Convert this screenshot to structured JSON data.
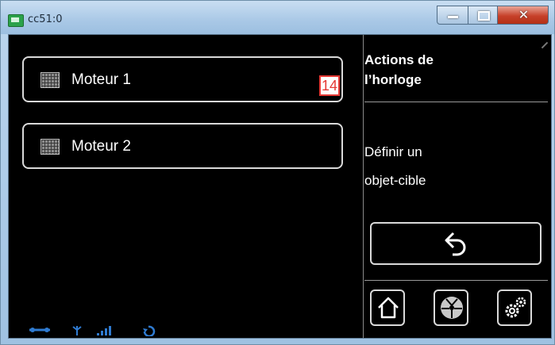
{
  "window": {
    "title": "cc51:0"
  },
  "motors": [
    {
      "label": "Moteur 1"
    },
    {
      "label": "Moteur 2"
    }
  ],
  "badge": "14",
  "panel": {
    "title_line1": "Actions de",
    "title_line2": "l’horloge",
    "text_line1": "Définir un",
    "text_line2": "objet-cible"
  },
  "icons": {
    "motor": "grid-icon",
    "back": "back-arrow-icon",
    "home": "home-icon",
    "fan": "fan-icon",
    "settings": "gears-icon",
    "status": [
      "link-icon",
      "antenna-icon",
      "signal-bars-icon",
      "sync-icon"
    ]
  },
  "colors": {
    "accent": "#2f7bd1",
    "badge": "#e53935",
    "close": "#c7412a"
  }
}
